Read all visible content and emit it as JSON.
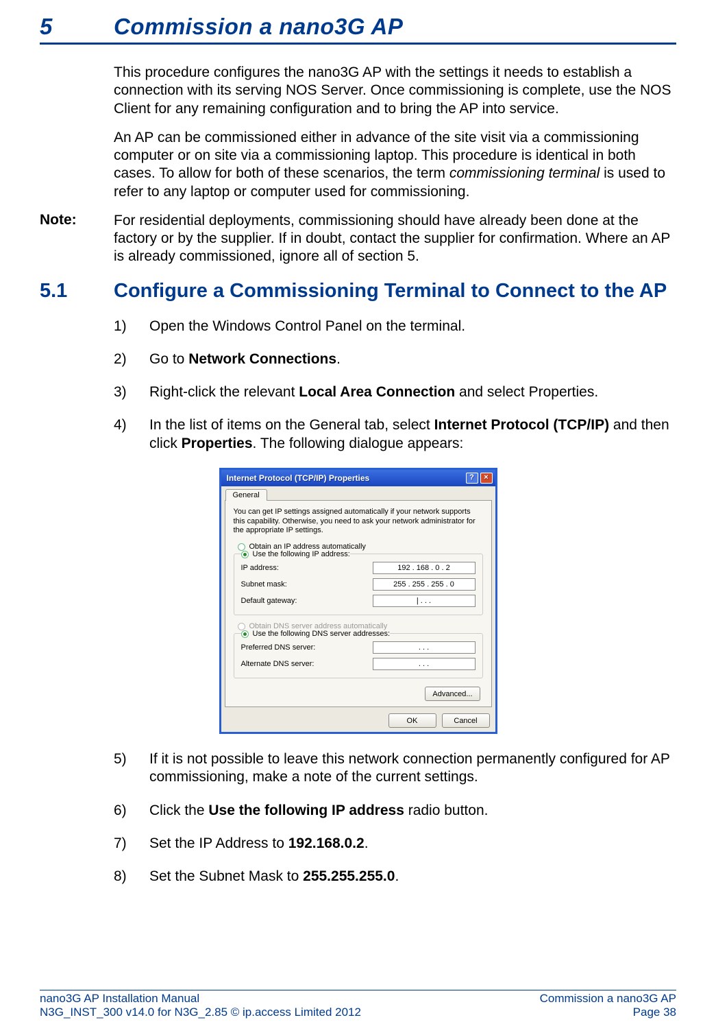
{
  "chapter": {
    "number": "5",
    "title": "Commission a nano3G AP"
  },
  "paragraphs": {
    "p1": "This procedure configures the nano3G AP with the settings it needs to establish a connection with its serving NOS Server. Once commissioning is complete, use the NOS Client for any remaining configuration and to bring the AP into service.",
    "p2_a": "An AP can be commissioned either in advance of the site visit via a commissioning computer or on site via a commissioning laptop. This procedure is identical in both cases. To allow for both of these scenarios, the term ",
    "p2_em": "commissioning terminal",
    "p2_b": " is used to refer to any laptop or computer used for commissioning."
  },
  "note": {
    "label": "Note:",
    "text": "For residential deployments, commissioning should have already been done at the factory or by the supplier. If in doubt, contact the supplier for confirmation. Where an AP is already commissioned, ignore all of section 5."
  },
  "section": {
    "number": "5.1",
    "title": "Configure a Commissioning Terminal to Connect to the AP"
  },
  "steps": {
    "s1": {
      "n": "1)",
      "text": "Open the Windows Control Panel on the terminal."
    },
    "s2": {
      "n": "2)",
      "a": "Go to ",
      "b": "Network Connections",
      "c": "."
    },
    "s3": {
      "n": "3)",
      "a": "Right-click the relevant ",
      "b": "Local Area Connection",
      "c": " and select Properties."
    },
    "s4": {
      "n": "4)",
      "a": "In the list of items on the General tab, select ",
      "b": "Internet Protocol (TCP/IP)",
      "c": " and then click ",
      "d": "Properties",
      "e": ". The following dialogue appears:"
    },
    "s5": {
      "n": "5)",
      "text": "If it is not possible to leave this network connection permanently configured for AP commissioning, make a note of the current settings."
    },
    "s6": {
      "n": "6)",
      "a": "Click the ",
      "b": "Use the following IP address",
      "c": " radio button."
    },
    "s7": {
      "n": "7)",
      "a": "Set the IP Address to ",
      "b": "192.168.0.2",
      "c": "."
    },
    "s8": {
      "n": "8)",
      "a": "Set the Subnet Mask to ",
      "b": "255.255.255.0",
      "c": "."
    }
  },
  "dialog": {
    "title": "Internet Protocol (TCP/IP) Properties",
    "help_icon": "?",
    "close_icon": "×",
    "tab": "General",
    "help_text": "You can get IP settings assigned automatically if your network supports this capability. Otherwise, you need to ask your network administrator for the appropriate IP settings.",
    "opt_auto_ip": "Obtain an IP address automatically",
    "opt_use_ip": "Use the following IP address:",
    "lbl_ip": "IP address:",
    "lbl_subnet": "Subnet mask:",
    "lbl_gateway": "Default gateway:",
    "val_ip": "192 . 168 .   0   .   2",
    "val_subnet": "255 . 255 . 255 .   0",
    "val_gateway": "|     .        .        .",
    "opt_auto_dns": "Obtain DNS server address automatically",
    "opt_use_dns": "Use the following DNS server addresses:",
    "lbl_pref_dns": "Preferred DNS server:",
    "lbl_alt_dns": "Alternate DNS server:",
    "val_blank": ".        .        .",
    "btn_advanced": "Advanced...",
    "btn_ok": "OK",
    "btn_cancel": "Cancel"
  },
  "footer": {
    "left1": "nano3G AP Installation Manual",
    "left2": "N3G_INST_300 v14.0 for N3G_2.85 © ip.access Limited 2012",
    "right1": "Commission a nano3G AP",
    "right2": "Page 38"
  }
}
